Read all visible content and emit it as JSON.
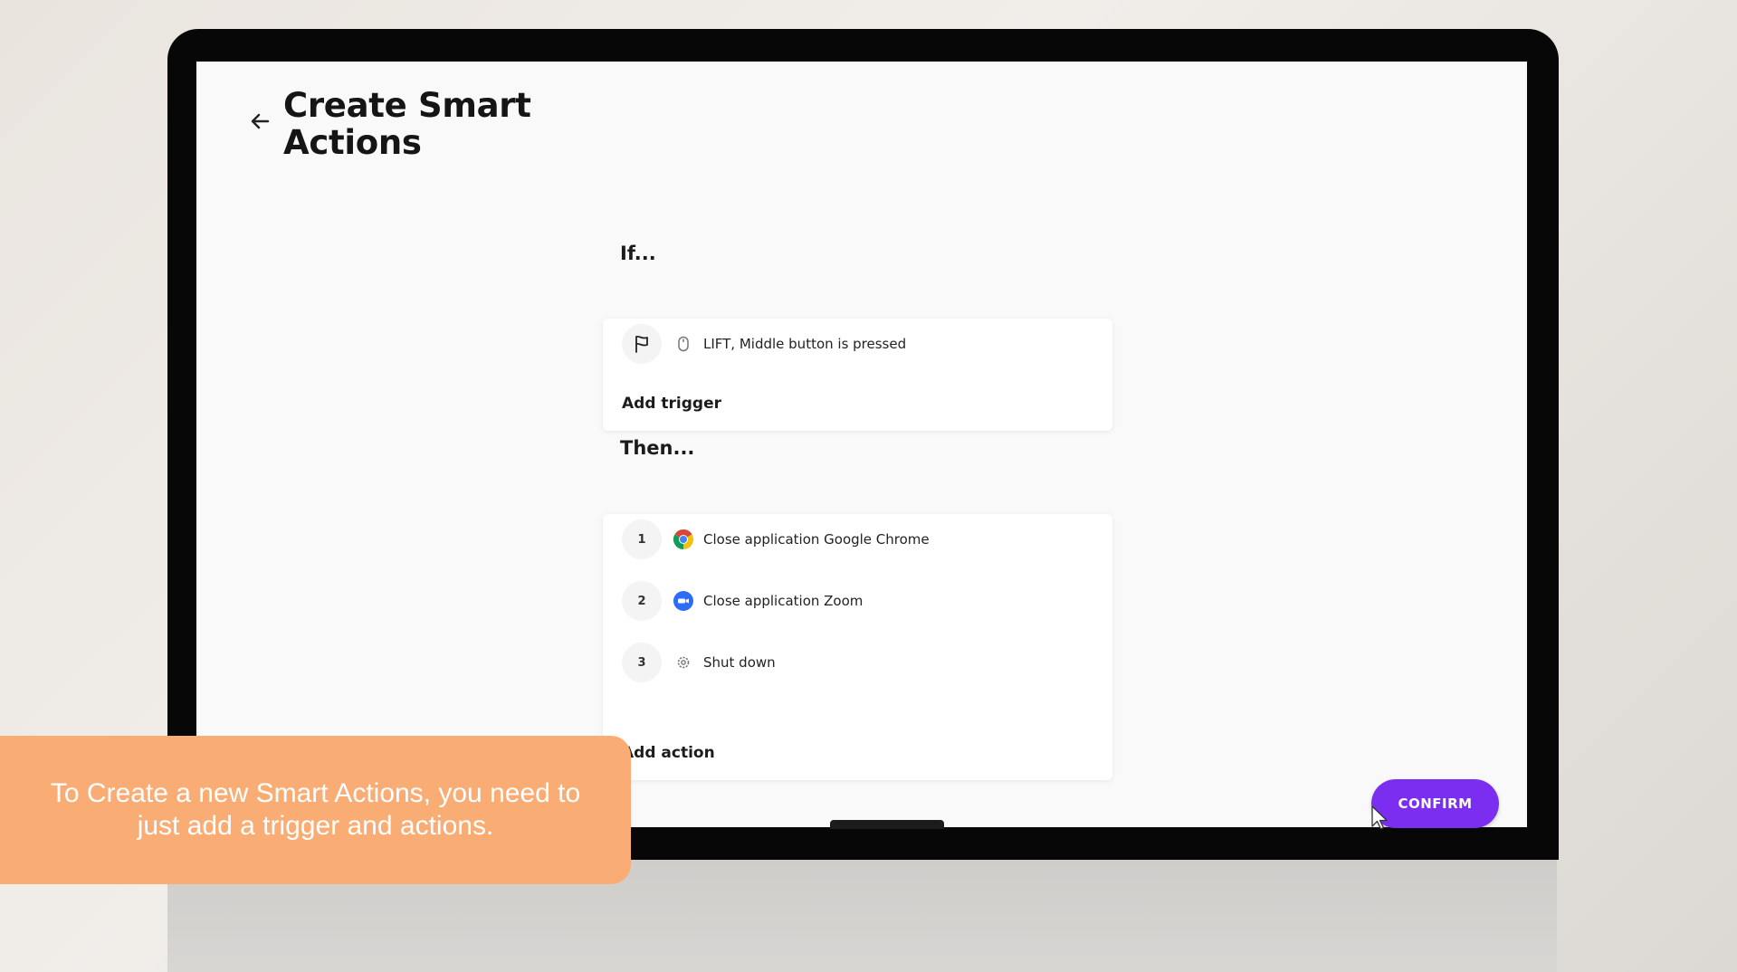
{
  "page": {
    "title": "Create Smart Actions",
    "back_icon": "arrow-left-icon"
  },
  "if_section": {
    "label": "If...",
    "trigger": {
      "icon": "flag-icon",
      "device_icon": "mouse-icon",
      "text": "LIFT, Middle button is pressed"
    },
    "add_label": "Add trigger"
  },
  "then_section": {
    "label": "Then...",
    "actions": [
      {
        "number": "1",
        "icon": "chrome-icon",
        "text": "Close application Google Chrome"
      },
      {
        "number": "2",
        "icon": "zoom-icon",
        "text": "Close application Zoom"
      },
      {
        "number": "3",
        "icon": "gear-icon",
        "text": "Shut down"
      }
    ],
    "add_label": "Add action"
  },
  "confirm_button": {
    "label": "CONFIRM",
    "color": "#7b2df0"
  },
  "caption": {
    "text": "To Create a new Smart Actions, you need to just add a trigger and actions.",
    "color": "#f9ad74"
  }
}
